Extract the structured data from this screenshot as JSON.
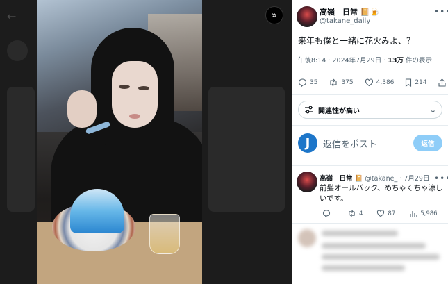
{
  "media_viewer": {
    "expand_icon_glyph": "»"
  },
  "post": {
    "display_name": "高嶺　日常",
    "name_emoji": "📔🍺",
    "handle": "@takane_daily",
    "text": "来年も僕と一緒に花火みよ、？",
    "time": "午後8:14",
    "date": "2024年7月29日",
    "views_count": "13万",
    "views_label": "件の表示",
    "replies": "35",
    "reposts": "375",
    "likes": "4,386",
    "bookmarks": "214"
  },
  "sort": {
    "label": "関連性が高い"
  },
  "composer": {
    "avatar_letter": "J",
    "placeholder": "返信をポスト",
    "reply_button": "返信"
  },
  "reply": {
    "display_name": "高嶺　日常",
    "name_emoji": "📔",
    "handle": "@takane_",
    "date": "7月29日",
    "text": "前髪オールバック、めちゃくちゃ涼しいです。",
    "reposts": "4",
    "likes": "87",
    "views": "5,986"
  }
}
